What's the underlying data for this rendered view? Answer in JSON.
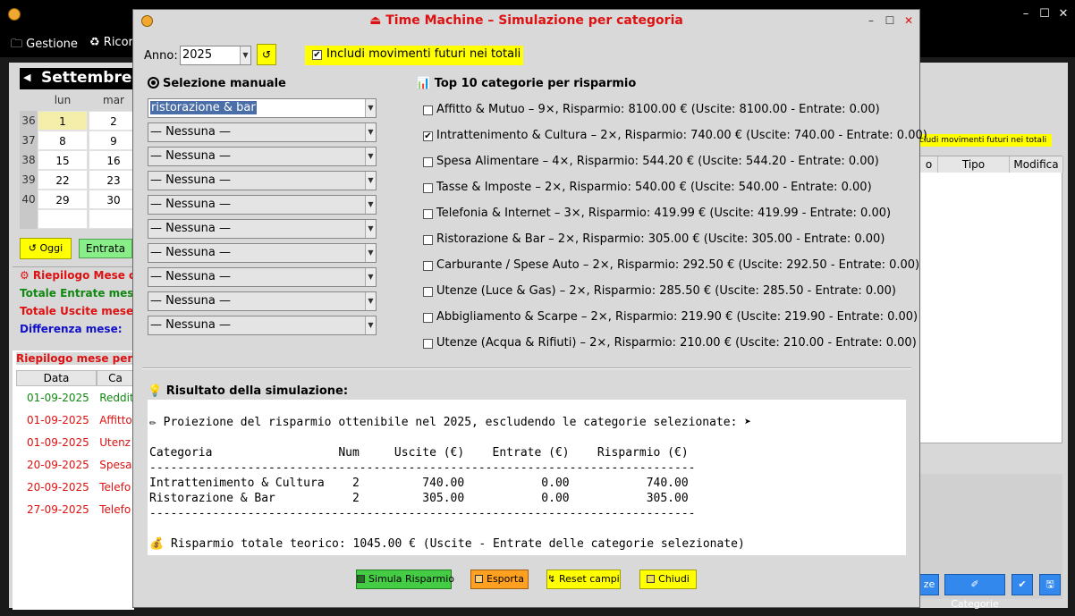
{
  "main": {
    "menu": {
      "gestione": "Gestione",
      "ricor": "♻ Ricor"
    },
    "calendar": {
      "month": "Settembre",
      "day_headers": [
        "lun",
        "mar"
      ],
      "weeks": [
        {
          "wk": "36",
          "d1": "1",
          "d2": "2"
        },
        {
          "wk": "37",
          "d1": "8",
          "d2": "9"
        },
        {
          "wk": "38",
          "d1": "15",
          "d2": "16"
        },
        {
          "wk": "39",
          "d1": "22",
          "d2": "23"
        },
        {
          "wk": "40",
          "d1": "29",
          "d2": "30"
        }
      ]
    },
    "btn_oggi": "↺ Oggi",
    "btn_entrata": "Entrata",
    "riepilogo": {
      "title": "⚙ Riepilogo Mese co",
      "entrate": "Totale Entrate mese:",
      "uscite": "Totale Uscite mese:",
      "differenza": "Differenza mese:"
    },
    "riepilogo_mese": {
      "title": "Riepilogo mese per c",
      "headers": [
        "Data",
        "Ca"
      ],
      "rows": [
        {
          "date": "01-09-2025",
          "cat": "Reddit"
        },
        {
          "date": "01-09-2025",
          "cat": "Affitto"
        },
        {
          "date": "01-09-2025",
          "cat": "Utenz"
        },
        {
          "date": "20-09-2025",
          "cat": "Spesa"
        },
        {
          "date": "20-09-2025",
          "cat": "Telefo"
        },
        {
          "date": "27-09-2025",
          "cat": "Telefo"
        }
      ]
    },
    "right": {
      "futuri_chip": "cludi movimenti futuri nei totali",
      "headers": [
        "o",
        "Tipo",
        "Modifica"
      ],
      "buttons": [
        "ze",
        "✐ Categorie",
        "✔",
        "🖫"
      ]
    },
    "window_controls": [
      "–",
      "☐",
      "✕"
    ]
  },
  "dialog": {
    "title": "⏏ Time Machine – Simulazione per categoria",
    "window_controls": [
      "–",
      "☐",
      "✕"
    ],
    "anno_label": "Anno:",
    "anno_value": "2025",
    "refresh": "↺",
    "futuri_label": "Includi movimenti futuri nei totali",
    "futuri_checked": "✔",
    "selezione_title": "Selezione manuale",
    "combos": [
      "ristorazione & bar",
      "— Nessuna —",
      "— Nessuna —",
      "— Nessuna —",
      "— Nessuna —",
      "— Nessuna —",
      "— Nessuna —",
      "— Nessuna —",
      "— Nessuna —",
      "— Nessuna —"
    ],
    "top_title": "📊 Top 10 categorie per risparmio",
    "top_items": [
      {
        "label": "Affitto & Mutuo – 9×, Risparmio: 8100.00 € (Uscite: 8100.00 - Entrate: 0.00)",
        "check": ""
      },
      {
        "label": "Intrattenimento & Cultura – 2×, Risparmio: 740.00 € (Uscite: 740.00 - Entrate: 0.00)",
        "check": "✔"
      },
      {
        "label": "Spesa Alimentare – 4×, Risparmio: 544.20 € (Uscite: 544.20 - Entrate: 0.00)",
        "check": ""
      },
      {
        "label": "Tasse & Imposte – 2×, Risparmio: 540.00 € (Uscite: 540.00 - Entrate: 0.00)",
        "check": ""
      },
      {
        "label": "Telefonia & Internet – 3×, Risparmio: 419.99 € (Uscite: 419.99 - Entrate: 0.00)",
        "check": ""
      },
      {
        "label": "Ristorazione & Bar – 2×, Risparmio: 305.00 € (Uscite: 305.00 - Entrate: 0.00)",
        "check": ""
      },
      {
        "label": "Carburante / Spese Auto – 2×, Risparmio: 292.50 € (Uscite: 292.50 - Entrate: 0.00)",
        "check": ""
      },
      {
        "label": "Utenze (Luce & Gas) – 2×, Risparmio: 285.50 € (Uscite: 285.50 - Entrate: 0.00)",
        "check": ""
      },
      {
        "label": "Abbigliamento & Scarpe – 2×, Risparmio: 219.90 € (Uscite: 219.90 - Entrate: 0.00)",
        "check": ""
      },
      {
        "label": "Utenze (Acqua & Rifiuti) – 2×, Risparmio: 210.00 € (Uscite: 210.00 - Entrate: 0.00)",
        "check": ""
      }
    ],
    "risultato_title": "💡 Risultato della simulazione:",
    "result_lines": [
      "",
      "✏ Proiezione del risparmio ottenibile nel 2025, escludendo le categorie selezionate: ➤",
      "",
      "Categoria                  Num     Uscite (€)    Entrate (€)    Risparmio (€)",
      "------------------------------------------------------------------------------",
      "Intrattenimento & Cultura    2         740.00           0.00           740.00",
      "Ristorazione & Bar           2         305.00           0.00           305.00",
      "------------------------------------------------------------------------------",
      "",
      "💰 Risparmio totale teorico: 1045.00 € (Uscite - Entrate delle categorie selezionate)"
    ],
    "buttons": {
      "simula": "Simula Risparmio",
      "esporta": "Esporta",
      "reset": "↯ Reset campi",
      "chiudi": "Chiudi"
    }
  }
}
